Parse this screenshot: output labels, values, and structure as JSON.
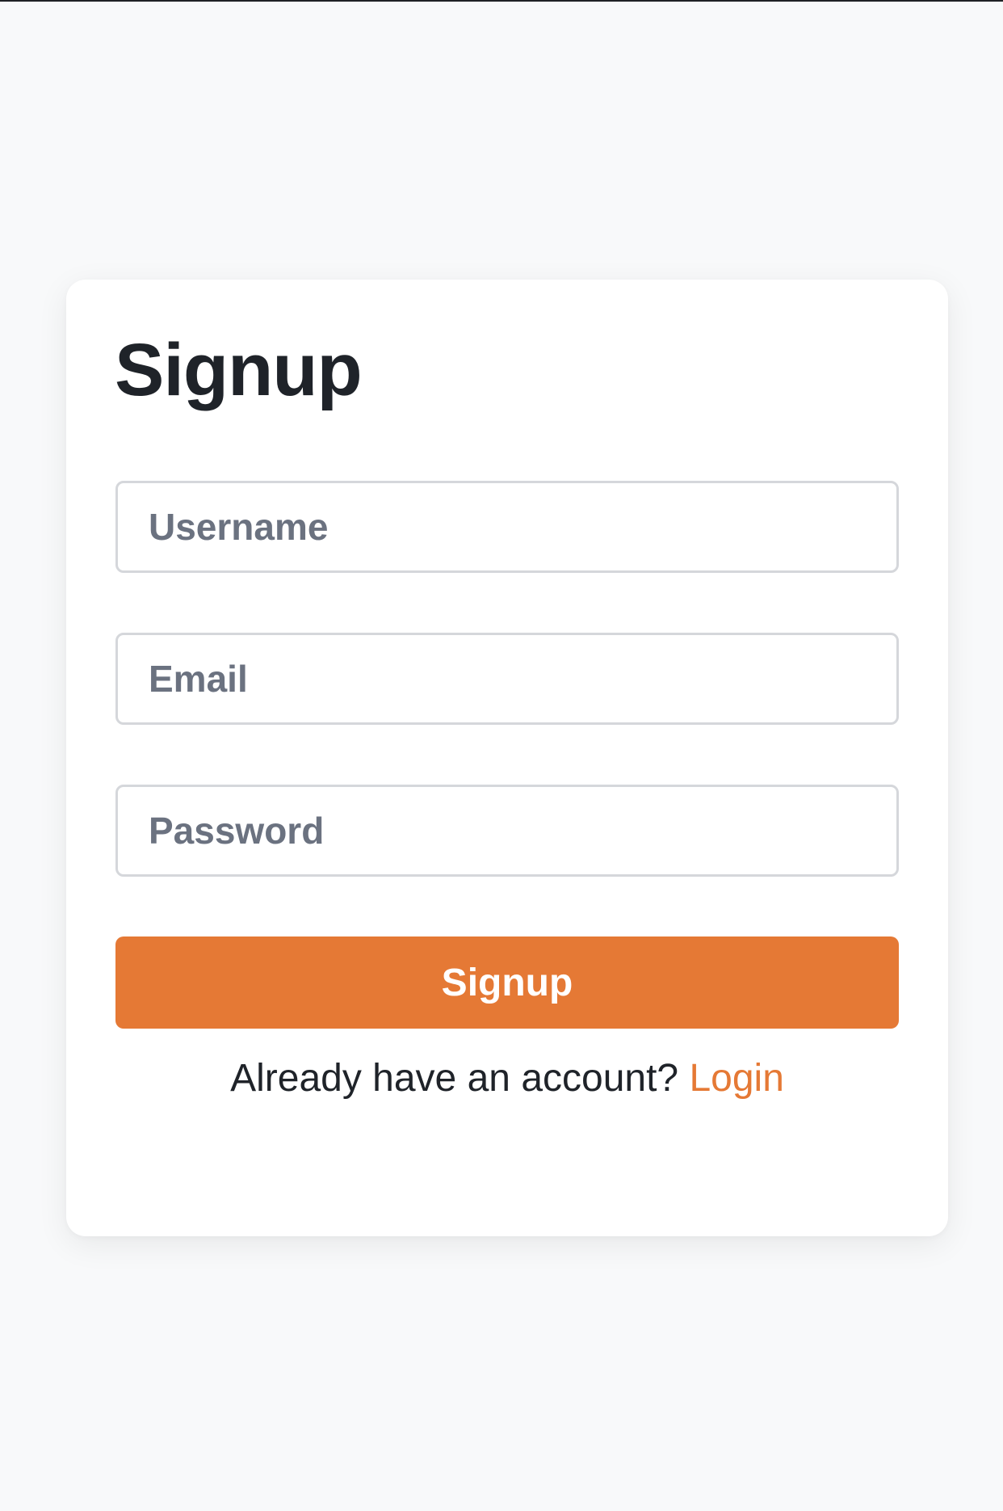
{
  "form": {
    "title": "Signup",
    "username_placeholder": "Username",
    "email_placeholder": "Email",
    "password_placeholder": "Password",
    "submit_label": "Signup"
  },
  "footer": {
    "prompt": "Already have an account?",
    "login_link": "Login"
  },
  "colors": {
    "accent": "#e57935",
    "background": "#f8f9fa",
    "card": "#ffffff",
    "text": "#1f2329",
    "placeholder": "#6b7280",
    "border": "#d5d7db"
  }
}
